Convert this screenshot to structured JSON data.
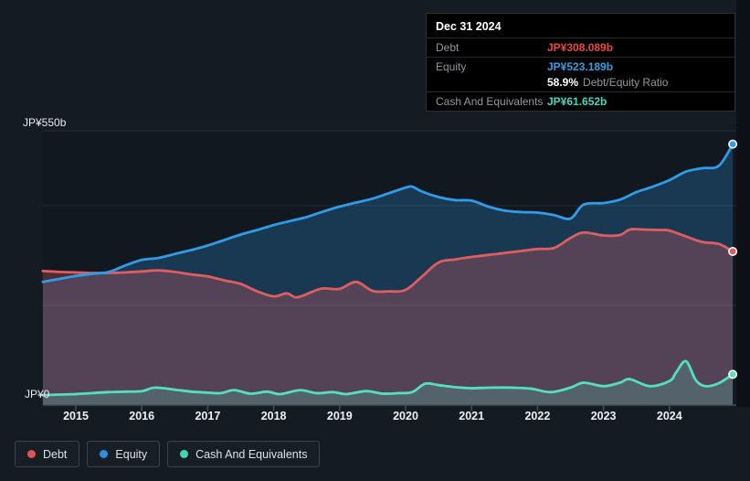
{
  "tooltip": {
    "date": "Dec 31 2024",
    "debt_label": "Debt",
    "debt_value": "JP¥308.089b",
    "equity_label": "Equity",
    "equity_value": "JP¥523.189b",
    "ratio_value": "58.9%",
    "ratio_label": "Debt/Equity Ratio",
    "cash_label": "Cash And Equivalents",
    "cash_value": "JP¥61.652b"
  },
  "axis": {
    "y_top_label": "JP¥550b",
    "y_bottom_label": "JP¥0",
    "years": [
      "2015",
      "2016",
      "2017",
      "2018",
      "2019",
      "2020",
      "2021",
      "2022",
      "2023",
      "2024"
    ]
  },
  "legend": {
    "items": [
      {
        "label": "Debt",
        "color": "#e25353"
      },
      {
        "label": "Equity",
        "color": "#2e8fdc"
      },
      {
        "label": "Cash And Equivalents",
        "color": "#44d6b4"
      }
    ]
  },
  "colors": {
    "background": "#151b23",
    "debt_line": "#de5d60",
    "equity_line": "#2f9ce8",
    "cash_line": "#55dfc2",
    "gridline": "rgba(255,255,255,0.08)",
    "axis_line": "#454e57"
  },
  "chart_data": {
    "type": "area",
    "unit": "JP¥ billions",
    "ylim": [
      0,
      550
    ],
    "gridline_values": [
      200,
      400,
      550
    ],
    "x_range": [
      2014.5,
      2024.96
    ],
    "legend_position": "bottom-left",
    "series": [
      {
        "name": "Debt",
        "color": "#de5d60",
        "end_value": 308.089,
        "points": [
          [
            2014.5,
            269
          ],
          [
            2014.75,
            267
          ],
          [
            2015,
            266
          ],
          [
            2015.25,
            265
          ],
          [
            2015.5,
            265
          ],
          [
            2015.75,
            266
          ],
          [
            2016,
            268
          ],
          [
            2016.25,
            270
          ],
          [
            2016.5,
            267
          ],
          [
            2016.75,
            262
          ],
          [
            2017,
            258
          ],
          [
            2017.25,
            250
          ],
          [
            2017.5,
            243
          ],
          [
            2017.75,
            228
          ],
          [
            2018,
            218
          ],
          [
            2018.2,
            224
          ],
          [
            2018.35,
            216
          ],
          [
            2018.6,
            228
          ],
          [
            2018.75,
            234
          ],
          [
            2019,
            233
          ],
          [
            2019.25,
            247
          ],
          [
            2019.5,
            229
          ],
          [
            2019.75,
            228
          ],
          [
            2020,
            231
          ],
          [
            2020.25,
            258
          ],
          [
            2020.5,
            286
          ],
          [
            2020.75,
            292
          ],
          [
            2021,
            297
          ],
          [
            2021.25,
            301
          ],
          [
            2021.5,
            305
          ],
          [
            2021.75,
            309
          ],
          [
            2022,
            313
          ],
          [
            2022.25,
            315
          ],
          [
            2022.5,
            335
          ],
          [
            2022.7,
            346
          ],
          [
            2023,
            340
          ],
          [
            2023.25,
            341
          ],
          [
            2023.4,
            352
          ],
          [
            2023.6,
            352
          ],
          [
            2023.85,
            351
          ],
          [
            2024,
            350
          ],
          [
            2024.25,
            338
          ],
          [
            2024.5,
            327
          ],
          [
            2024.75,
            323
          ],
          [
            2024.96,
            308.089
          ]
        ]
      },
      {
        "name": "Equity",
        "color": "#2f9ce8",
        "end_value": 523.189,
        "points": [
          [
            2014.5,
            247
          ],
          [
            2014.75,
            253
          ],
          [
            2015,
            259
          ],
          [
            2015.25,
            263
          ],
          [
            2015.5,
            267
          ],
          [
            2015.75,
            280
          ],
          [
            2016,
            291
          ],
          [
            2016.25,
            295
          ],
          [
            2016.5,
            303
          ],
          [
            2016.75,
            311
          ],
          [
            2017,
            320
          ],
          [
            2017.25,
            331
          ],
          [
            2017.5,
            342
          ],
          [
            2017.75,
            351
          ],
          [
            2018,
            361
          ],
          [
            2018.25,
            369
          ],
          [
            2018.5,
            377
          ],
          [
            2018.75,
            388
          ],
          [
            2019,
            398
          ],
          [
            2019.25,
            406
          ],
          [
            2019.5,
            414
          ],
          [
            2019.75,
            425
          ],
          [
            2020,
            436
          ],
          [
            2020.1,
            438
          ],
          [
            2020.25,
            428
          ],
          [
            2020.5,
            417
          ],
          [
            2020.75,
            411
          ],
          [
            2021,
            410
          ],
          [
            2021.25,
            398
          ],
          [
            2021.5,
            390
          ],
          [
            2021.75,
            387
          ],
          [
            2022,
            386
          ],
          [
            2022.25,
            381
          ],
          [
            2022.5,
            374
          ],
          [
            2022.7,
            402
          ],
          [
            2023,
            405
          ],
          [
            2023.25,
            412
          ],
          [
            2023.5,
            427
          ],
          [
            2023.75,
            438
          ],
          [
            2024,
            451
          ],
          [
            2024.25,
            468
          ],
          [
            2024.5,
            475
          ],
          [
            2024.75,
            480
          ],
          [
            2024.96,
            523.189
          ]
        ]
      },
      {
        "name": "Cash And Equivalents",
        "color": "#55dfc2",
        "end_value": 61.652,
        "points": [
          [
            2014.5,
            20
          ],
          [
            2014.75,
            21
          ],
          [
            2015,
            22
          ],
          [
            2015.25,
            24
          ],
          [
            2015.5,
            26
          ],
          [
            2015.75,
            27
          ],
          [
            2016,
            28
          ],
          [
            2016.2,
            35
          ],
          [
            2016.5,
            31
          ],
          [
            2016.75,
            27
          ],
          [
            2017,
            25
          ],
          [
            2017.2,
            24
          ],
          [
            2017.4,
            30
          ],
          [
            2017.65,
            23
          ],
          [
            2017.9,
            27
          ],
          [
            2018.1,
            22
          ],
          [
            2018.4,
            30
          ],
          [
            2018.65,
            24
          ],
          [
            2018.9,
            26
          ],
          [
            2019.1,
            22
          ],
          [
            2019.4,
            28
          ],
          [
            2019.65,
            23
          ],
          [
            2019.9,
            24
          ],
          [
            2020.1,
            26
          ],
          [
            2020.3,
            43
          ],
          [
            2020.5,
            40
          ],
          [
            2020.75,
            36
          ],
          [
            2021,
            34
          ],
          [
            2021.3,
            35
          ],
          [
            2021.6,
            35
          ],
          [
            2021.9,
            33
          ],
          [
            2022.2,
            26
          ],
          [
            2022.5,
            35
          ],
          [
            2022.7,
            45
          ],
          [
            2023,
            38
          ],
          [
            2023.25,
            45
          ],
          [
            2023.4,
            52
          ],
          [
            2023.7,
            38
          ],
          [
            2024,
            48
          ],
          [
            2024.1,
            65
          ],
          [
            2024.25,
            88
          ],
          [
            2024.4,
            50
          ],
          [
            2024.55,
            38
          ],
          [
            2024.75,
            44
          ],
          [
            2024.96,
            61.652
          ]
        ]
      }
    ]
  }
}
